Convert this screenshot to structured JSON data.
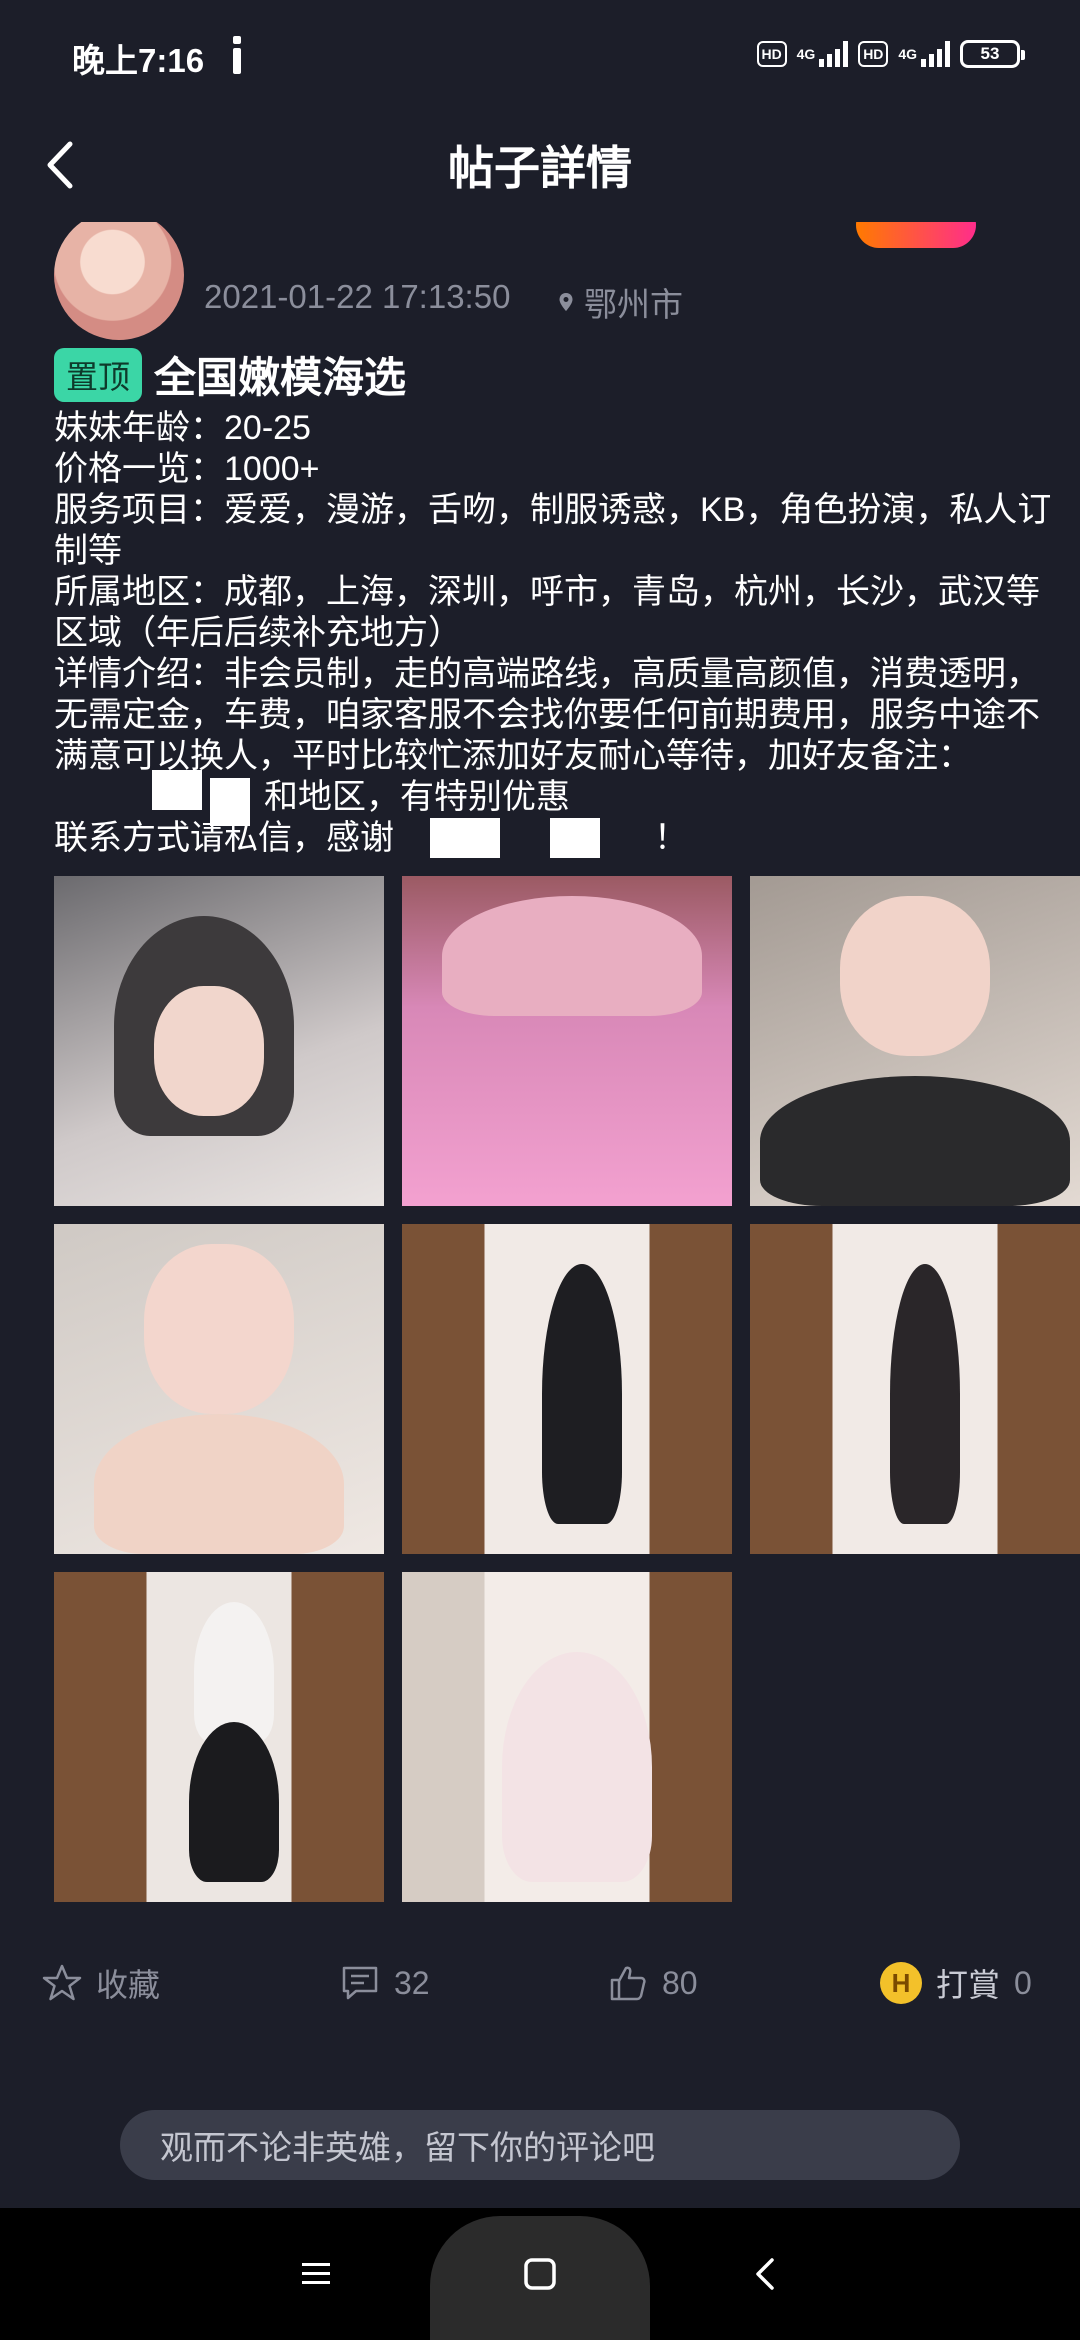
{
  "status_bar": {
    "time": "晚上7:16",
    "hd1": "HD",
    "net1": "4G",
    "hd2": "HD",
    "net2": "4G",
    "battery": "53"
  },
  "header": {
    "title": "帖子詳情"
  },
  "post": {
    "datetime": "2021-01-22 17:13:50",
    "location": "鄂州市",
    "pin_badge": "置顶",
    "title": "全国嫩模海选",
    "lines": [
      "妹妹年龄：20-25",
      "价格一览：1000+",
      "服务项目：爱爱，漫游，舌吻，制服诱惑，KB，角色扮演，私人订制等",
      "所属地区：成都，上海，深圳，呼市，青岛，杭州，长沙，武汉等区域（年后后续补充地方）",
      "详情介绍：非会员制，走的高端路线，高质量高颜值，消费透明，无需定金，车费，咱家客服不会找你要任何前期费用，服务中途不满意可以换人，平时比较忙添加好友耐心等待，加好友备注：",
      "和地区，有特别优惠",
      "联系方式请私信，感谢",
      "！"
    ]
  },
  "actions": {
    "favorite": "收藏",
    "comments": "32",
    "likes": "80",
    "reward": "打賞",
    "reward_count": "0"
  },
  "comment_input": {
    "placeholder": "观而不论非英雄，留下你的评论吧"
  },
  "colors": {
    "background": "#1c1e29",
    "pin_badge": "#3bd6a6",
    "muted_text": "#8b8e9b",
    "coin": "#f3c12a"
  }
}
